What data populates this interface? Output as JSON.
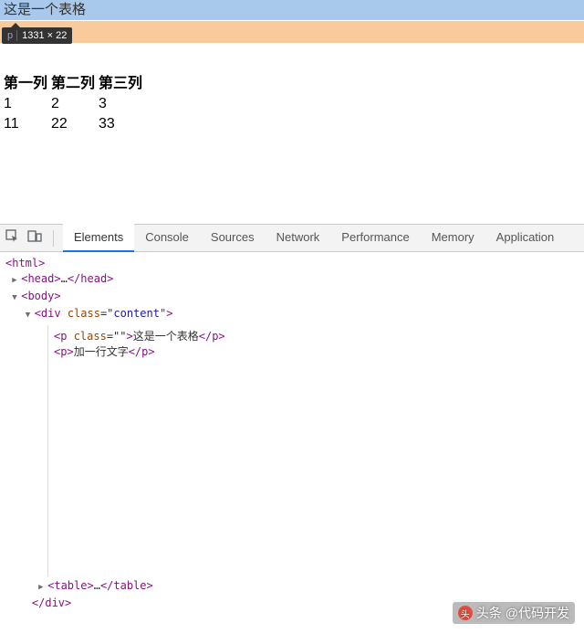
{
  "page": {
    "highlighted_text": "这是一个表格",
    "tooltip_tag": "p",
    "tooltip_dims": "1331 × 22",
    "table": {
      "headers": [
        "第一列",
        "第二列",
        "第三列"
      ],
      "rows": [
        [
          "1",
          "2",
          "3"
        ],
        [
          "11",
          "22",
          "33"
        ]
      ]
    }
  },
  "devtools": {
    "tabs": [
      "Elements",
      "Console",
      "Sources",
      "Network",
      "Performance",
      "Memory",
      "Application"
    ],
    "active_tab": "Elements",
    "dom": {
      "l1": "<html>",
      "l2_open": "<head>",
      "l2_ell": "…",
      "l2_close": "</head>",
      "l3": "<body>",
      "l4_pre": "<div ",
      "l4_attr": "class",
      "l4_eq": "=\"",
      "l4_val": "content",
      "l4_post": "\">",
      "l5_pre": "<p ",
      "l5_attr": "class",
      "l5_eq": "=\"\"",
      "l5_close": ">",
      "l5_txt": "这是一个表格",
      "l5_end": "</p>",
      "l6_open": "<p>",
      "l6_txt": "加一行文字",
      "l6_close": "</p>",
      "l7_open": "<table>",
      "l7_ell": "…",
      "l7_close": "</table>",
      "l8": "</div>"
    }
  },
  "watermark": {
    "prefix": "头条",
    "text": "@代码开发"
  }
}
